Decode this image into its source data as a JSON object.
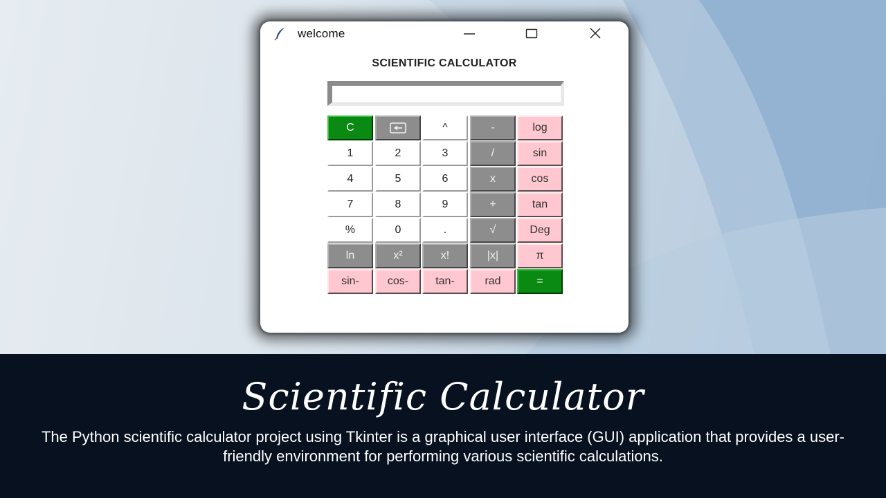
{
  "window": {
    "title": "welcome",
    "heading": "SCIENTIFIC CALCULATOR",
    "display_value": ""
  },
  "keypad": {
    "rows": [
      [
        {
          "label": "C",
          "style": "green"
        },
        {
          "label": "",
          "icon": "backspace-icon",
          "style": "gray"
        },
        {
          "label": "^",
          "style": "white"
        },
        {
          "label": "-",
          "style": "gray"
        },
        {
          "label": "log",
          "style": "pink"
        }
      ],
      [
        {
          "label": "1",
          "style": "white"
        },
        {
          "label": "2",
          "style": "white"
        },
        {
          "label": "3",
          "style": "white"
        },
        {
          "label": "/",
          "style": "gray"
        },
        {
          "label": "sin",
          "style": "pink"
        }
      ],
      [
        {
          "label": "4",
          "style": "white"
        },
        {
          "label": "5",
          "style": "white"
        },
        {
          "label": "6",
          "style": "white"
        },
        {
          "label": "x",
          "style": "gray"
        },
        {
          "label": "cos",
          "style": "pink"
        }
      ],
      [
        {
          "label": "7",
          "style": "white"
        },
        {
          "label": "8",
          "style": "white"
        },
        {
          "label": "9",
          "style": "white"
        },
        {
          "label": "+",
          "style": "gray"
        },
        {
          "label": "tan",
          "style": "pink"
        }
      ],
      [
        {
          "label": "%",
          "style": "white"
        },
        {
          "label": "0",
          "style": "white"
        },
        {
          "label": ".",
          "style": "white"
        },
        {
          "label": "√",
          "style": "gray"
        },
        {
          "label": "Deg",
          "style": "pink"
        }
      ],
      [
        {
          "label": "ln",
          "style": "gray"
        },
        {
          "label": "x²",
          "style": "gray"
        },
        {
          "label": "x!",
          "style": "gray"
        },
        {
          "label": "|x|",
          "style": "gray"
        },
        {
          "label": "π",
          "style": "pink"
        }
      ],
      [
        {
          "label": "sin-",
          "style": "pink"
        },
        {
          "label": "cos-",
          "style": "pink"
        },
        {
          "label": "tan-",
          "style": "pink"
        },
        {
          "label": "rad",
          "style": "pink"
        },
        {
          "label": "=",
          "style": "green"
        }
      ]
    ]
  },
  "caption": {
    "title": "Scientific Calculator",
    "description": "The Python scientific calculator project using Tkinter is a graphical user interface (GUI) application that provides a user-friendly environment for performing various scientific calculations."
  },
  "colors": {
    "caption_bg": "#071120",
    "key_green": "#0a8a12",
    "key_gray": "#8d8d8d",
    "key_pink": "#ffc7cf"
  }
}
